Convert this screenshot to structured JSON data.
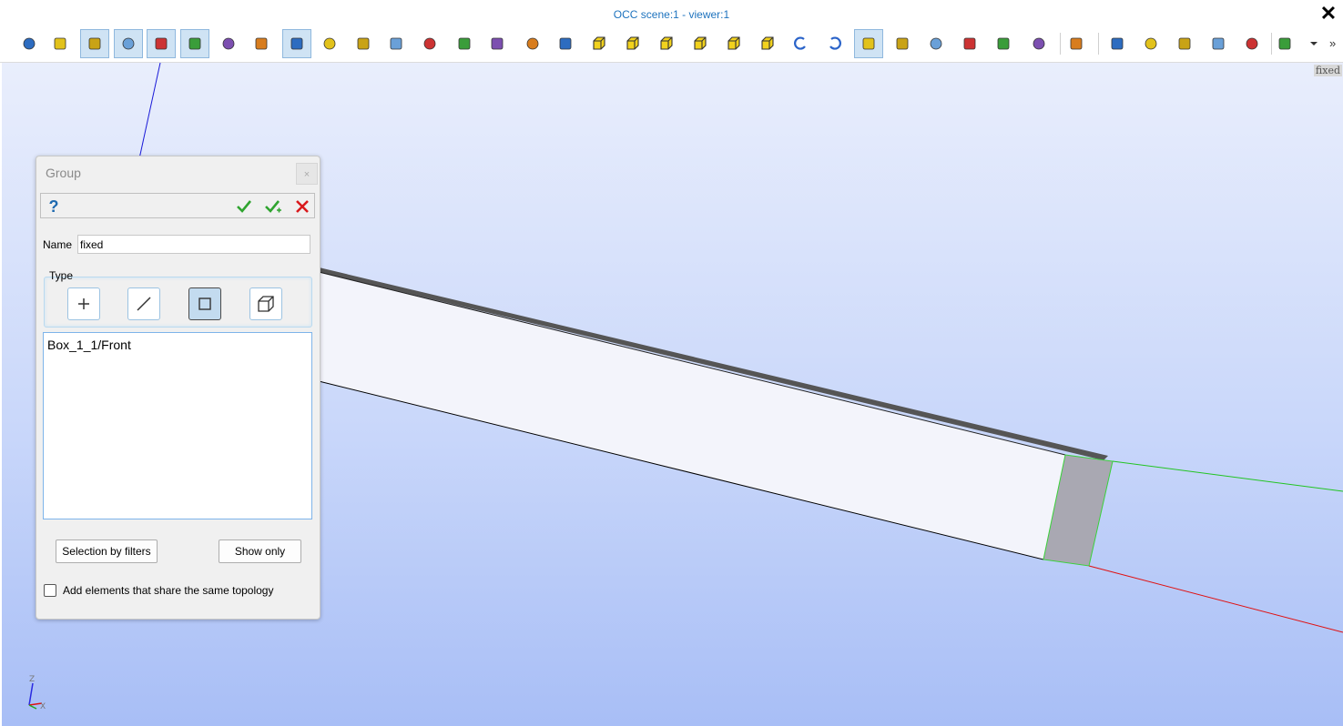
{
  "window": {
    "title": "OCC scene:1 - viewer:1",
    "close_glyph": "✕"
  },
  "toolbar": {
    "items": [
      {
        "icon": "dump-view-icon"
      },
      {
        "icon": "mouse-icon"
      },
      {
        "icon": "select-edge-icon",
        "active": true
      },
      {
        "icon": "select-face-icon",
        "active": true
      },
      {
        "icon": "select-solid-icon",
        "active": true
      },
      {
        "icon": "rectangle-select-icon",
        "active": true
      },
      {
        "icon": "polygon-select-icon"
      },
      {
        "icon": "circle-select-icon"
      },
      {
        "icon": "trihedron-icon",
        "active": true
      },
      {
        "icon": "fit-all-icon"
      },
      {
        "icon": "fit-area-icon"
      },
      {
        "icon": "zoom-icon"
      },
      {
        "icon": "zoom-selection-icon"
      },
      {
        "icon": "pan-icon"
      },
      {
        "icon": "global-pan-icon"
      },
      {
        "icon": "rotate-icon"
      },
      {
        "icon": "rotation-point-icon"
      },
      {
        "icon": "front-view-icon"
      },
      {
        "icon": "back-view-icon"
      },
      {
        "icon": "top-view-icon"
      },
      {
        "icon": "bottom-view-icon"
      },
      {
        "icon": "left-view-icon"
      },
      {
        "icon": "right-view-icon"
      },
      {
        "icon": "rotate-ccw-icon"
      },
      {
        "icon": "rotate-cw-icon"
      },
      {
        "icon": "ortho-projection-icon",
        "active": true
      },
      {
        "icon": "perspective-icon"
      },
      {
        "icon": "stereo-icon"
      },
      {
        "icon": "reset-icon"
      },
      {
        "icon": "memorize-view-icon"
      },
      {
        "icon": "restore-view-icon"
      },
      {
        "icon": "clone-view-icon"
      },
      {
        "icon": "clipping-icon"
      },
      {
        "icon": "scale-icon"
      },
      {
        "icon": "graduated-axes-icon"
      },
      {
        "icon": "ambient-light-icon"
      },
      {
        "icon": "style-switch-icon"
      },
      {
        "icon": "minimize-icon"
      },
      {
        "icon": "more-dropdown-icon"
      }
    ],
    "overflow_glyph": "»"
  },
  "viewport": {
    "label": "fixed",
    "triad": {
      "z": "Z",
      "x": "X"
    }
  },
  "dialog": {
    "title": "Group",
    "close_glyph": "×",
    "help_glyph": "?",
    "name_label": "Name",
    "name_value": "fixed",
    "type_label": "Type",
    "types": [
      {
        "name": "node",
        "selected": false
      },
      {
        "name": "edge",
        "selected": false
      },
      {
        "name": "face",
        "selected": true
      },
      {
        "name": "volume",
        "selected": false
      }
    ],
    "elements": [
      "Box_1_1/Front"
    ],
    "selection_by_filters": "Selection by filters",
    "show_only": "Show only",
    "share_topology_label": "Add elements that share the same topology",
    "share_topology_checked": false
  },
  "colors": {
    "title_blue": "#1e73be",
    "apply_green": "#2fa42f",
    "cancel_red": "#d9191c",
    "face_gray": "#a9a8b2"
  }
}
